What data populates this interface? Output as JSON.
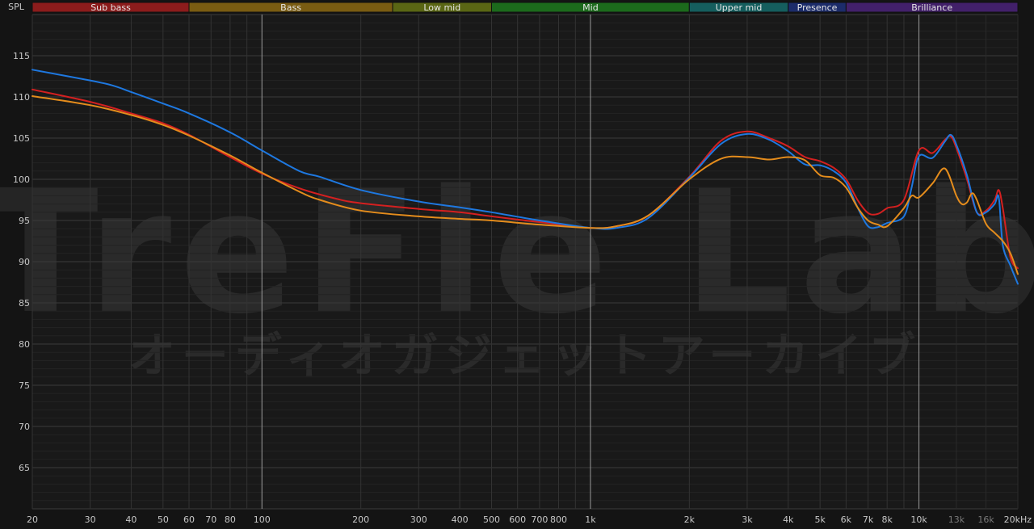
{
  "chart_data": {
    "type": "line",
    "ylabel": "SPL",
    "x_scale": "log",
    "xlim": [
      20,
      20000
    ],
    "ylim": [
      60,
      120
    ],
    "grid": true,
    "y_ticks": [
      65,
      70,
      75,
      80,
      85,
      90,
      95,
      100,
      105,
      110,
      115
    ],
    "x_ticks": [
      {
        "value": 20,
        "label": "20"
      },
      {
        "value": 30,
        "label": "30"
      },
      {
        "value": 40,
        "label": "40"
      },
      {
        "value": 50,
        "label": "50"
      },
      {
        "value": 60,
        "label": "60"
      },
      {
        "value": 70,
        "label": "70"
      },
      {
        "value": 80,
        "label": "80"
      },
      {
        "value": 100,
        "label": "100"
      },
      {
        "value": 200,
        "label": "200"
      },
      {
        "value": 300,
        "label": "300"
      },
      {
        "value": 400,
        "label": "400"
      },
      {
        "value": 500,
        "label": "500"
      },
      {
        "value": 600,
        "label": "600"
      },
      {
        "value": 700,
        "label": "700"
      },
      {
        "value": 800,
        "label": "800"
      },
      {
        "value": 1000,
        "label": "1k"
      },
      {
        "value": 2000,
        "label": "2k"
      },
      {
        "value": 3000,
        "label": "3k"
      },
      {
        "value": 4000,
        "label": "4k"
      },
      {
        "value": 5000,
        "label": "5k"
      },
      {
        "value": 6000,
        "label": "6k"
      },
      {
        "value": 7000,
        "label": "7k"
      },
      {
        "value": 8000,
        "label": "8k"
      },
      {
        "value": 10000,
        "label": "10k"
      },
      {
        "value": 13000,
        "label": "13k"
      },
      {
        "value": 16000,
        "label": "16k"
      },
      {
        "value": 20000,
        "label": "20kHz"
      }
    ],
    "bands": [
      {
        "label": "Sub bass",
        "from": 20,
        "to": 60,
        "color": "#8c1c1c"
      },
      {
        "label": "Bass",
        "from": 60,
        "to": 250,
        "color": "#7a5c12"
      },
      {
        "label": "Low mid",
        "from": 250,
        "to": 500,
        "color": "#5a6614"
      },
      {
        "label": "Mid",
        "from": 500,
        "to": 2000,
        "color": "#1c6a1c"
      },
      {
        "label": "Upper mid",
        "from": 2000,
        "to": 4000,
        "color": "#155e5e"
      },
      {
        "label": "Presence",
        "from": 4000,
        "to": 6000,
        "color": "#1c2c6a"
      },
      {
        "label": "Brilliance",
        "from": 6000,
        "to": 20000,
        "color": "#42206a"
      }
    ],
    "series": [
      {
        "color": "#d42020",
        "points": [
          [
            20,
            110.9
          ],
          [
            30,
            109.4
          ],
          [
            40,
            108
          ],
          [
            50,
            106.8
          ],
          [
            60,
            105.4
          ],
          [
            80,
            102.7
          ],
          [
            100,
            100.7
          ],
          [
            130,
            98.9
          ],
          [
            170,
            97.6
          ],
          [
            200,
            97.1
          ],
          [
            300,
            96.4
          ],
          [
            400,
            96
          ],
          [
            500,
            95.5
          ],
          [
            700,
            94.8
          ],
          [
            1000,
            94.1
          ],
          [
            1200,
            94.3
          ],
          [
            1500,
            95.6
          ],
          [
            2000,
            100.3
          ],
          [
            2500,
            104.7
          ],
          [
            3000,
            105.8
          ],
          [
            3500,
            105
          ],
          [
            4000,
            104
          ],
          [
            4500,
            102.7
          ],
          [
            5000,
            102.2
          ],
          [
            5500,
            101.4
          ],
          [
            6000,
            100
          ],
          [
            6500,
            97.5
          ],
          [
            7000,
            95.9
          ],
          [
            7500,
            95.8
          ],
          [
            8000,
            96.5
          ],
          [
            9000,
            97.5
          ],
          [
            10000,
            103.5
          ],
          [
            11000,
            103.2
          ],
          [
            12000,
            104.8
          ],
          [
            12500,
            105.2
          ],
          [
            13000,
            103.8
          ],
          [
            14000,
            100
          ],
          [
            15000,
            96
          ],
          [
            16000,
            96.2
          ],
          [
            17000,
            97.5
          ],
          [
            17500,
            98.7
          ],
          [
            18000,
            96.5
          ],
          [
            19000,
            90.5
          ],
          [
            20000,
            89.2
          ]
        ]
      },
      {
        "color": "#1e78e0",
        "points": [
          [
            20,
            113.3
          ],
          [
            30,
            112
          ],
          [
            35,
            111.4
          ],
          [
            40,
            110.6
          ],
          [
            50,
            109.2
          ],
          [
            60,
            108
          ],
          [
            80,
            105.7
          ],
          [
            100,
            103.5
          ],
          [
            130,
            101
          ],
          [
            150,
            100.3
          ],
          [
            200,
            98.7
          ],
          [
            300,
            97.3
          ],
          [
            400,
            96.6
          ],
          [
            500,
            96
          ],
          [
            700,
            95
          ],
          [
            1000,
            94.1
          ],
          [
            1200,
            94.1
          ],
          [
            1500,
            95.3
          ],
          [
            2000,
            100.2
          ],
          [
            2500,
            104.3
          ],
          [
            3000,
            105.5
          ],
          [
            3500,
            104.8
          ],
          [
            4000,
            103.4
          ],
          [
            4500,
            101.8
          ],
          [
            5000,
            101.7
          ],
          [
            5500,
            101
          ],
          [
            6000,
            99.6
          ],
          [
            6500,
            96.6
          ],
          [
            7000,
            94.3
          ],
          [
            7500,
            94.2
          ],
          [
            8000,
            94.7
          ],
          [
            9000,
            95.5
          ],
          [
            9500,
            99
          ],
          [
            10000,
            102.8
          ],
          [
            11000,
            102.6
          ],
          [
            12000,
            104.6
          ],
          [
            12500,
            105.4
          ],
          [
            13000,
            104.2
          ],
          [
            14000,
            100.5
          ],
          [
            15000,
            96
          ],
          [
            16000,
            96
          ],
          [
            17000,
            97
          ],
          [
            17500,
            97.8
          ],
          [
            18000,
            92
          ],
          [
            19000,
            89.5
          ],
          [
            20000,
            87.3
          ]
        ]
      },
      {
        "color": "#e48c1c",
        "points": [
          [
            20,
            110.1
          ],
          [
            30,
            109
          ],
          [
            40,
            107.8
          ],
          [
            50,
            106.6
          ],
          [
            60,
            105.3
          ],
          [
            80,
            102.9
          ],
          [
            100,
            100.8
          ],
          [
            130,
            98.5
          ],
          [
            150,
            97.5
          ],
          [
            200,
            96.2
          ],
          [
            300,
            95.5
          ],
          [
            400,
            95.2
          ],
          [
            500,
            95
          ],
          [
            700,
            94.5
          ],
          [
            1000,
            94.1
          ],
          [
            1200,
            94.3
          ],
          [
            1500,
            95.6
          ],
          [
            2000,
            100
          ],
          [
            2500,
            102.5
          ],
          [
            3000,
            102.7
          ],
          [
            3500,
            102.4
          ],
          [
            4000,
            102.7
          ],
          [
            4500,
            102.3
          ],
          [
            5000,
            100.5
          ],
          [
            5500,
            100.2
          ],
          [
            6000,
            99
          ],
          [
            6500,
            96.6
          ],
          [
            7000,
            95
          ],
          [
            7500,
            94.5
          ],
          [
            8000,
            94.3
          ],
          [
            9000,
            96.5
          ],
          [
            9500,
            98
          ],
          [
            10000,
            97.8
          ],
          [
            11000,
            99.5
          ],
          [
            12000,
            101.3
          ],
          [
            13000,
            98
          ],
          [
            13500,
            97
          ],
          [
            14000,
            97.2
          ],
          [
            14500,
            98.3
          ],
          [
            15000,
            97.5
          ],
          [
            16000,
            94.6
          ],
          [
            17000,
            93.5
          ],
          [
            18000,
            92.5
          ],
          [
            19000,
            91
          ],
          [
            20000,
            88.5
          ]
        ]
      }
    ]
  },
  "watermark": {
    "title": "TreFle Lab",
    "subtitle": "オーディオガジェットアーカイブ"
  }
}
